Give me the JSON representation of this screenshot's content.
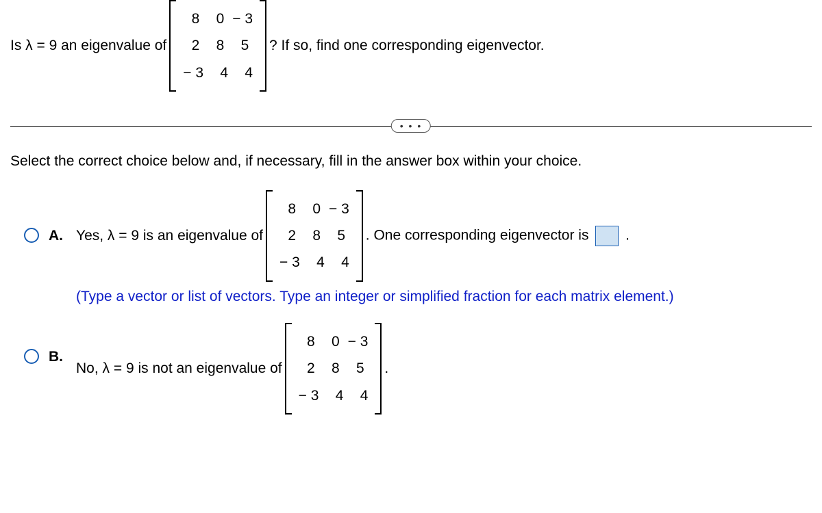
{
  "question": {
    "prefix": "Is λ = 9 an eigenvalue of",
    "suffix": "? If so, find one corresponding eigenvector."
  },
  "matrix": {
    "rows": [
      [
        "8",
        "0",
        "− 3"
      ],
      [
        "2",
        "8",
        "5"
      ],
      [
        "− 3",
        "4",
        "4"
      ]
    ]
  },
  "dots": "• • •",
  "instruction": "Select the correct choice below and, if necessary, fill in the answer box within your choice.",
  "choiceA": {
    "label": "A.",
    "textBefore": "Yes, λ = 9 is an eigenvalue of",
    "textAfter1": ". One corresponding eigenvector is",
    "period": ".",
    "hint": "(Type a vector or list of vectors. Type an integer or simplified fraction for each matrix element.)"
  },
  "choiceB": {
    "label": "B.",
    "textBefore": "No, λ = 9 is not an eigenvalue of",
    "period": "."
  }
}
